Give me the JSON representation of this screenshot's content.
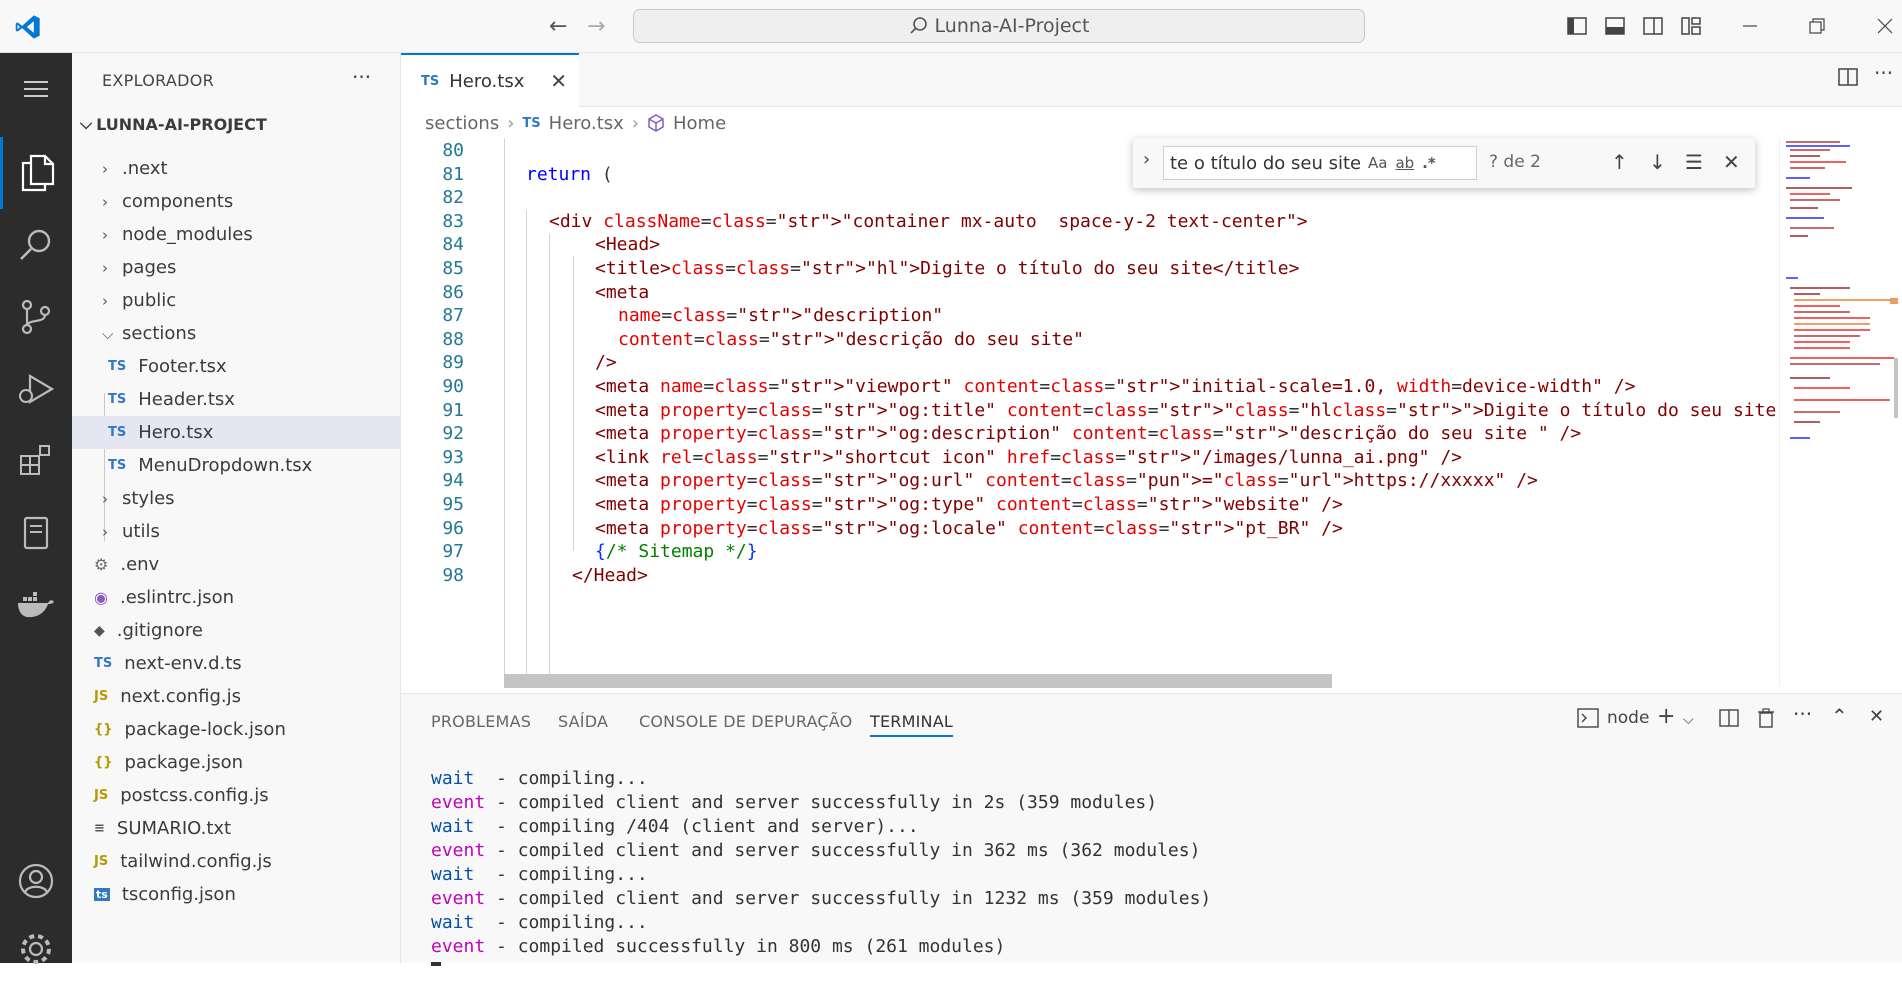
{
  "titlebar": {
    "search_text": "Lunna-AI-Project"
  },
  "sidebar": {
    "header": "EXPLORADOR",
    "project": "LUNNA-AI-PROJECT",
    "items": [
      {
        "label": ".next",
        "kind": "folder"
      },
      {
        "label": "components",
        "kind": "folder"
      },
      {
        "label": "node_modules",
        "kind": "folder"
      },
      {
        "label": "pages",
        "kind": "folder"
      },
      {
        "label": "public",
        "kind": "folder"
      },
      {
        "label": "sections",
        "kind": "folder-open"
      },
      {
        "label": "Footer.tsx",
        "kind": "ts",
        "icon": "TS"
      },
      {
        "label": "Header.tsx",
        "kind": "ts",
        "icon": "TS"
      },
      {
        "label": "Hero.tsx",
        "kind": "ts",
        "icon": "TS"
      },
      {
        "label": "MenuDropdown.tsx",
        "kind": "ts",
        "icon": "TS"
      },
      {
        "label": "styles",
        "kind": "folder"
      },
      {
        "label": "utils",
        "kind": "folder"
      },
      {
        "label": ".env",
        "kind": "gear"
      },
      {
        "label": ".eslintrc.json",
        "kind": "eslint"
      },
      {
        "label": ".gitignore",
        "kind": "git"
      },
      {
        "label": "next-env.d.ts",
        "kind": "ts",
        "icon": "TS"
      },
      {
        "label": "next.config.js",
        "kind": "js",
        "icon": "JS"
      },
      {
        "label": "package-lock.json",
        "kind": "json",
        "icon": "{}"
      },
      {
        "label": "package.json",
        "kind": "json",
        "icon": "{}"
      },
      {
        "label": "postcss.config.js",
        "kind": "js",
        "icon": "JS"
      },
      {
        "label": "SUMARIO.txt",
        "kind": "txt",
        "icon": "≡"
      },
      {
        "label": "tailwind.config.js",
        "kind": "js",
        "icon": "JS"
      },
      {
        "label": "tsconfig.json",
        "kind": "tsconfig",
        "icon": "ts"
      }
    ]
  },
  "editor": {
    "tab_label": "Hero.tsx",
    "tab_icon": "TS",
    "breadcrumb": [
      "sections",
      "Hero.tsx",
      "Home"
    ],
    "lines": [
      {
        "n": "80",
        "text": ""
      },
      {
        "n": "81",
        "text": "return ("
      },
      {
        "n": "82",
        "text": ""
      },
      {
        "n": "83",
        "text": "<div className=\"container mx-auto  space-y-2 text-center\">"
      },
      {
        "n": "84",
        "text": "<Head>"
      },
      {
        "n": "85",
        "text": "<title>Digite o título do seu site</title>"
      },
      {
        "n": "86",
        "text": "<meta"
      },
      {
        "n": "87",
        "text": "name=\"description\""
      },
      {
        "n": "88",
        "text": "content=\"descrição do seu site\""
      },
      {
        "n": "89",
        "text": "/>"
      },
      {
        "n": "90",
        "text": "<meta name=\"viewport\" content=\"initial-scale=1.0, width=device-width\" />"
      },
      {
        "n": "91",
        "text": "<meta property=\"og:title\" content=\"Digite o título do seu site\" />"
      },
      {
        "n": "92",
        "text": "<meta property=\"og:description\" content=\"descrição do seu site \" />"
      },
      {
        "n": "93",
        "text": "<link rel=\"shortcut icon\" href=\"/images/lunna_ai.png\" />"
      },
      {
        "n": "94",
        "text": "<meta property=\"og:url\" content=\"https://xxxxx\" />"
      },
      {
        "n": "95",
        "text": "<meta property=\"og:type\" content=\"website\" />"
      },
      {
        "n": "96",
        "text": "<meta property=\"og:locale\" content=\"pt_BR\" />"
      },
      {
        "n": "97",
        "text": "{/* Sitemap */}"
      },
      {
        "n": "98",
        "text": "</Head>"
      }
    ]
  },
  "find": {
    "value": "te o título do seu site",
    "opt_case": "Aa",
    "opt_word": "ab",
    "opt_regex": ".*",
    "count": "? de 2"
  },
  "panel": {
    "tabs": [
      "PROBLEMAS",
      "SAÍDA",
      "CONSOLE DE DEPURAÇÃO",
      "TERMINAL"
    ],
    "terminal_name": "node",
    "terminal_lines": [
      {
        "tag": "wait",
        "text": "  - compiling..."
      },
      {
        "tag": "event",
        "text": " - compiled client and server successfully in 2s (359 modules)"
      },
      {
        "tag": "wait",
        "text": "  - compiling /404 (client and server)..."
      },
      {
        "tag": "event",
        "text": " - compiled client and server successfully in 362 ms (362 modules)"
      },
      {
        "tag": "wait",
        "text": "  - compiling..."
      },
      {
        "tag": "event",
        "text": " - compiled client and server successfully in 1232 ms (359 modules)"
      },
      {
        "tag": "wait",
        "text": "  - compiling..."
      },
      {
        "tag": "event",
        "text": " - compiled successfully in 800 ms (261 modules)"
      }
    ]
  },
  "colors": {
    "accent": "#0078d4",
    "activity_bg": "#2c2c2c",
    "find_highlight": "#f6c9a8"
  }
}
